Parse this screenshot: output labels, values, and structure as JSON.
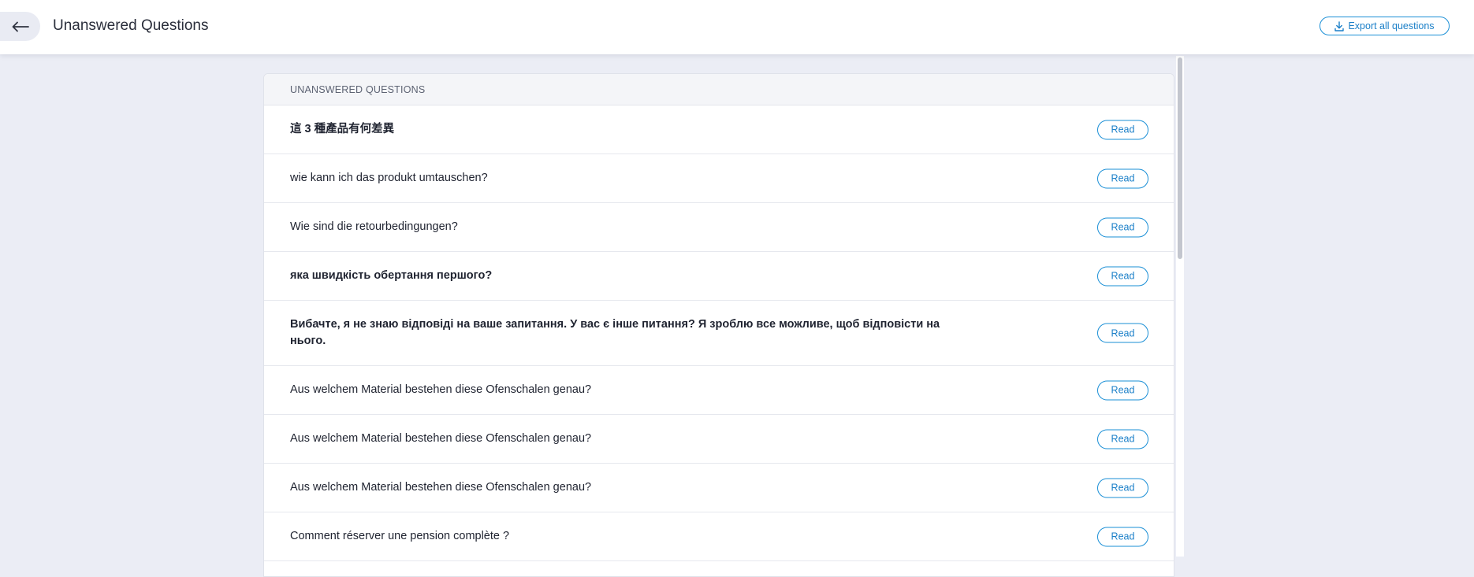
{
  "header": {
    "title": "Unanswered Questions",
    "back_icon": "arrow-left-icon",
    "export_label": "Export all questions",
    "export_icon": "download-icon"
  },
  "panel": {
    "heading": "UNANSWERED QUESTIONS",
    "read_label": "Read",
    "rows": [
      {
        "question": "這 3 種產品有何差異",
        "unread": true
      },
      {
        "question": "wie kann ich das produkt umtauschen?",
        "unread": false
      },
      {
        "question": "Wie sind die retourbedingungen?",
        "unread": false
      },
      {
        "question": "яка швидкість обертання першого?",
        "unread": true
      },
      {
        "question": "Вибачте, я не знаю відповіді на ваше запитання. У вас є інше питання? Я зроблю все можливе, щоб відповісти на нього.",
        "unread": true
      },
      {
        "question": "Aus welchem Material bestehen diese Ofenschalen genau?",
        "unread": false
      },
      {
        "question": "Aus welchem Material bestehen diese Ofenschalen genau?",
        "unread": false
      },
      {
        "question": "Aus welchem Material bestehen diese Ofenschalen genau?",
        "unread": false
      },
      {
        "question": "Comment réserver une pension complète ?",
        "unread": false
      }
    ]
  },
  "colors": {
    "accent": "#1a8fd6",
    "background": "#ebedf5",
    "panel_header": "#f4f5f8"
  }
}
